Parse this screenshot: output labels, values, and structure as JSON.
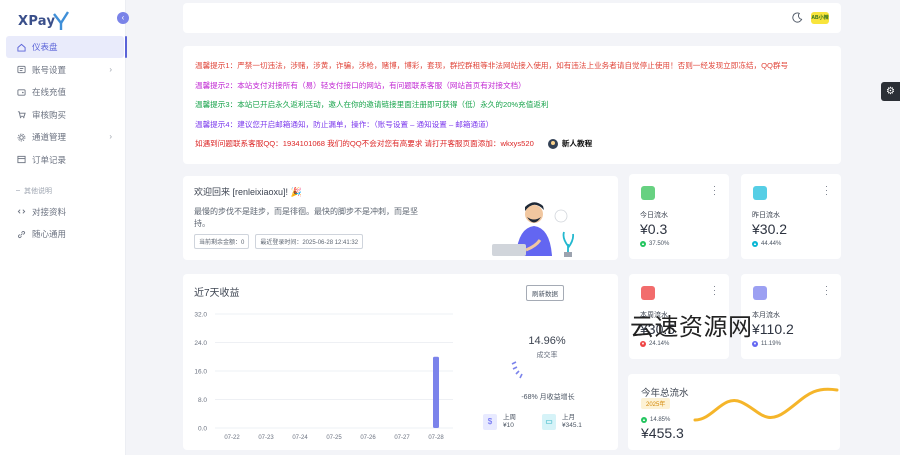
{
  "brand": {
    "name": "XPay",
    "accent": "#5a63d8"
  },
  "sidebar": {
    "items": [
      {
        "label": "仪表盘",
        "icon": "home-icon",
        "active": true
      },
      {
        "label": "账号设置",
        "icon": "card-icon",
        "has_children": true
      },
      {
        "label": "在线充值",
        "icon": "wallet-icon"
      },
      {
        "label": "审核购买",
        "icon": "cart-icon"
      },
      {
        "label": "通道管理",
        "icon": "settings-icon",
        "has_children": true
      },
      {
        "label": "订单记录",
        "icon": "list-icon"
      }
    ],
    "section_label": "其他说明",
    "extra_items": [
      {
        "label": "对接资料",
        "icon": "code-icon"
      },
      {
        "label": "随心通用",
        "icon": "link-icon"
      }
    ]
  },
  "header": {
    "avatar_text": "AB小辣"
  },
  "notices": [
    "温馨提示1：严禁一切违法，涉赌，涉黄，诈骗，涉枪，赌博，博彩，套现，群控群租等非法网站接入使用，如有违法上业务者请自觉停止使用！否则一经发现立即冻结，QQ群号",
    "温馨提示2：本站支付对接所有（易）轻支付接口的网站，有问题联系客服（网站首页有对接文档）",
    "温馨提示3：本站已开启永久返利活动，邀人在你的邀请链接里面注册即可获得（低）永久的20%充值返利",
    "温馨提示4：建议您开启邮箱通知，防止漏单，操作：（账号设置 – 通知设置 – 邮箱通道）",
    "如遇到问题联系客服QQ：1934101068 我们的QQ不会对您有高要求 请打开客服页面添加：wkxys520"
  ],
  "tutorial_label": "新人教程",
  "welcome": {
    "title": "欢迎回来 [renleixiaoxu]! 🎉",
    "subtitle": "最慢的步伐不是跬步，而是徘徊。最快的脚步不是冲刺，而是坚持。",
    "tag_balance": "当前剩余金额：0",
    "tag_login": "最近登录时间：2025-06-28 12:41:32"
  },
  "income_card": {
    "title": "近7天收益",
    "refresh_label": "刷新数据",
    "rate_value": "14.96%",
    "rate_label": "成交率",
    "growth_text": "-68% 月收益增长",
    "last_week_label": "上周",
    "last_week_value": "¥10",
    "last_month_label": "上月",
    "last_month_value": "¥345.1"
  },
  "chart_data": {
    "type": "bar",
    "title": "近7天收益",
    "categories": [
      "07-22",
      "07-23",
      "07-24",
      "07-25",
      "07-26",
      "07-27",
      "07-28"
    ],
    "values": [
      0,
      0,
      0,
      0,
      0,
      0,
      20
    ],
    "y_ticks": [
      "0.0",
      "8.0",
      "16.0",
      "24.0",
      "32.0"
    ],
    "ylim": [
      0,
      32
    ],
    "grid": true,
    "bar_color": "#7b83eb"
  },
  "stats": [
    {
      "title": "今日流水",
      "value": "¥0.3",
      "trend": "37.50%",
      "trend_dir": "up",
      "icon_color": "#4cc96b",
      "trend_color": "#22c55e"
    },
    {
      "title": "昨日流水",
      "value": "¥30.2",
      "trend": "44.44%",
      "trend_dir": "up",
      "icon_color": "#38c6e0",
      "trend_color": "#06b6d4"
    },
    {
      "title": "本周流水",
      "value": "¥30.5",
      "trend": "24.14%",
      "trend_dir": "down",
      "icon_color": "#f05252",
      "trend_color": "#ef4444"
    },
    {
      "title": "本月流水",
      "value": "¥110.2",
      "trend": "11.19%",
      "trend_dir": "down",
      "icon_color": "#8b8ff0",
      "trend_color": "#6366f1"
    }
  ],
  "yearly": {
    "title": "今年总流水",
    "badge": "2025年",
    "trend": "14.85%",
    "value": "¥455.3",
    "wave_color": "#f5b52a"
  },
  "watermark": "云速资源网"
}
